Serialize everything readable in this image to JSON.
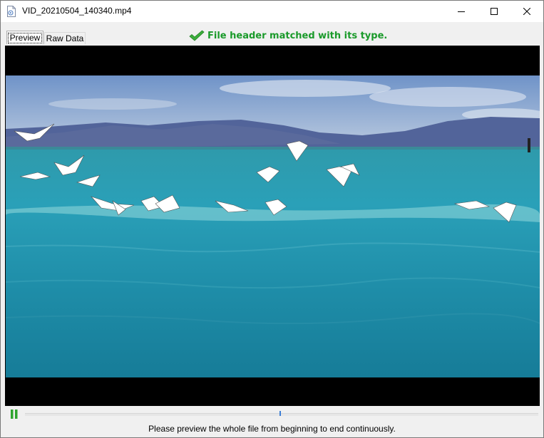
{
  "window": {
    "title": "VID_20210504_140340.mp4",
    "controls": {
      "minimize": "minimize",
      "maximize": "maximize",
      "close": "close"
    }
  },
  "tabs": [
    {
      "label": "Preview",
      "selected": true
    },
    {
      "label": "Raw Data",
      "selected": false
    }
  ],
  "status": {
    "message": "File header matched with its type.",
    "icon": "checkmark-icon",
    "color": "#1a9a2a"
  },
  "preview": {
    "content": "video-frame"
  },
  "playback": {
    "state": "playing",
    "control_icon": "pause-icon",
    "progress": 0.5,
    "hint": "Please preview the whole file from beginning to end continuously."
  },
  "colors": {
    "accent": "#3c7fd6",
    "success": "#1a9a2a"
  }
}
